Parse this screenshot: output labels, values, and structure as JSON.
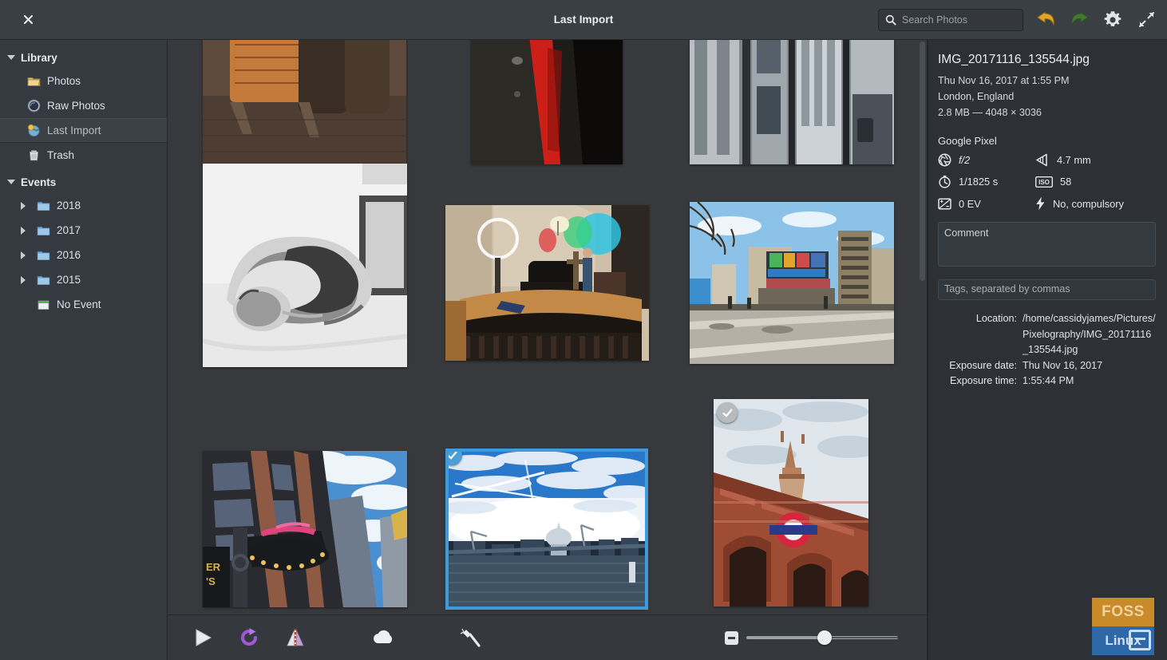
{
  "window": {
    "title": "Last Import",
    "close_label": "×"
  },
  "search": {
    "placeholder": "Search Photos",
    "value": "",
    "icon": "search-icon"
  },
  "header_actions": [
    {
      "name": "undo-icon",
      "label": "Undo"
    },
    {
      "name": "redo-icon",
      "label": "Redo"
    },
    {
      "name": "gear-icon",
      "label": "Settings"
    },
    {
      "name": "fullscreen-icon",
      "label": "Fullscreen"
    }
  ],
  "sidebar": {
    "groups": [
      {
        "label": "Library",
        "expanded": true,
        "items": [
          {
            "label": "Photos",
            "icon": "photos-folder-icon",
            "selected": false,
            "nested": false
          },
          {
            "label": "Raw Photos",
            "icon": "raw-photos-icon",
            "selected": false,
            "nested": false
          },
          {
            "label": "Last Import",
            "icon": "last-import-icon",
            "selected": true,
            "nested": false
          },
          {
            "label": "Trash",
            "icon": "trash-icon",
            "selected": false,
            "nested": false
          }
        ]
      },
      {
        "label": "Events",
        "expanded": true,
        "items": [
          {
            "label": "2018",
            "icon": "folder-icon",
            "selected": false,
            "nested": true,
            "expandable": true
          },
          {
            "label": "2017",
            "icon": "folder-icon",
            "selected": false,
            "nested": true,
            "expandable": true
          },
          {
            "label": "2016",
            "icon": "folder-icon",
            "selected": false,
            "nested": true,
            "expandable": true
          },
          {
            "label": "2015",
            "icon": "folder-icon",
            "selected": false,
            "nested": true,
            "expandable": true
          },
          {
            "label": "No Event",
            "icon": "no-event-icon",
            "selected": false,
            "nested": true,
            "expandable": false
          }
        ]
      }
    ]
  },
  "photos": [
    {
      "id": "p1",
      "alt": "wooden-bench-barrel",
      "selected": false,
      "checked": false
    },
    {
      "id": "p2",
      "alt": "red-scarf-dark-coat",
      "selected": false,
      "checked": false
    },
    {
      "id": "p3",
      "alt": "city-buildings-street-vertical",
      "selected": false,
      "checked": false
    },
    {
      "id": "p4",
      "alt": "sleeping-cat-black-white",
      "selected": false,
      "checked": false
    },
    {
      "id": "p5",
      "alt": "church-stage-band-concert",
      "selected": false,
      "checked": false
    },
    {
      "id": "p6",
      "alt": "city-intersection-blue-sky",
      "selected": false,
      "checked": false
    },
    {
      "id": "p7",
      "alt": "theater-marquee-looking-up",
      "selected": false,
      "checked": false
    },
    {
      "id": "p8",
      "alt": "london-thames-st-pauls-skyline",
      "selected": true,
      "checked": true
    },
    {
      "id": "p9",
      "alt": "st-pancras-underground-clocktower",
      "selected": false,
      "checked": true
    }
  ],
  "toolbar": {
    "buttons": [
      {
        "name": "play-slideshow-icon",
        "label": "Play Slideshow"
      },
      {
        "name": "rotate-right-icon",
        "label": "Rotate"
      },
      {
        "name": "flip-horizontal-icon",
        "label": "Flip"
      },
      {
        "name": "publish-cloud-icon",
        "label": "Publish"
      },
      {
        "name": "enhance-wand-icon",
        "label": "Enhance"
      }
    ],
    "zoom_out_label": "−",
    "zoom_value": 47
  },
  "metadata": {
    "filename": "IMG_20171116_135544.jpg",
    "datetime": "Thu Nov 16, 2017 at 1:55 PM",
    "location_name": "London, England",
    "size_dimensions": "2.8 MB — 4048 × 3036",
    "camera": "Google Pixel",
    "exif": [
      {
        "icon": "aperture-icon",
        "value": "f/2",
        "italic": true
      },
      {
        "icon": "focal-length-icon",
        "value": "4.7 mm",
        "italic": false
      },
      {
        "icon": "shutter-speed-icon",
        "value": "1/1825 s",
        "italic": false
      },
      {
        "icon": "iso-icon",
        "value": "58",
        "italic": false
      },
      {
        "icon": "exposure-compensation-icon",
        "value": "0 EV",
        "italic": false
      },
      {
        "icon": "flash-icon",
        "value": "No, compulsory",
        "italic": false
      }
    ],
    "comment_placeholder": "Comment",
    "comment_value": "",
    "tags_placeholder": "Tags, separated by commas",
    "tags_value": "",
    "details": [
      {
        "key": "Location:",
        "value": "/home/cassidyjames/Pictures/Pixelography/IMG_20171116_135544.jpg"
      },
      {
        "key": "Exposure date:",
        "value": "Thu Nov 16, 2017"
      },
      {
        "key": "Exposure time:",
        "value": "1:55:44 PM"
      }
    ]
  },
  "watermark": {
    "top_text": "FOSS",
    "bottom_text": "Linux"
  },
  "colors": {
    "accent_selection": "#3d9bdd",
    "check_on": "#4b9fd5",
    "check_off": "#b6bbbe",
    "header_bg": "#3a3f44",
    "sidebar_bg": "#343a3f",
    "grid_bg": "#37393d",
    "meta_bg": "#2d3034"
  }
}
